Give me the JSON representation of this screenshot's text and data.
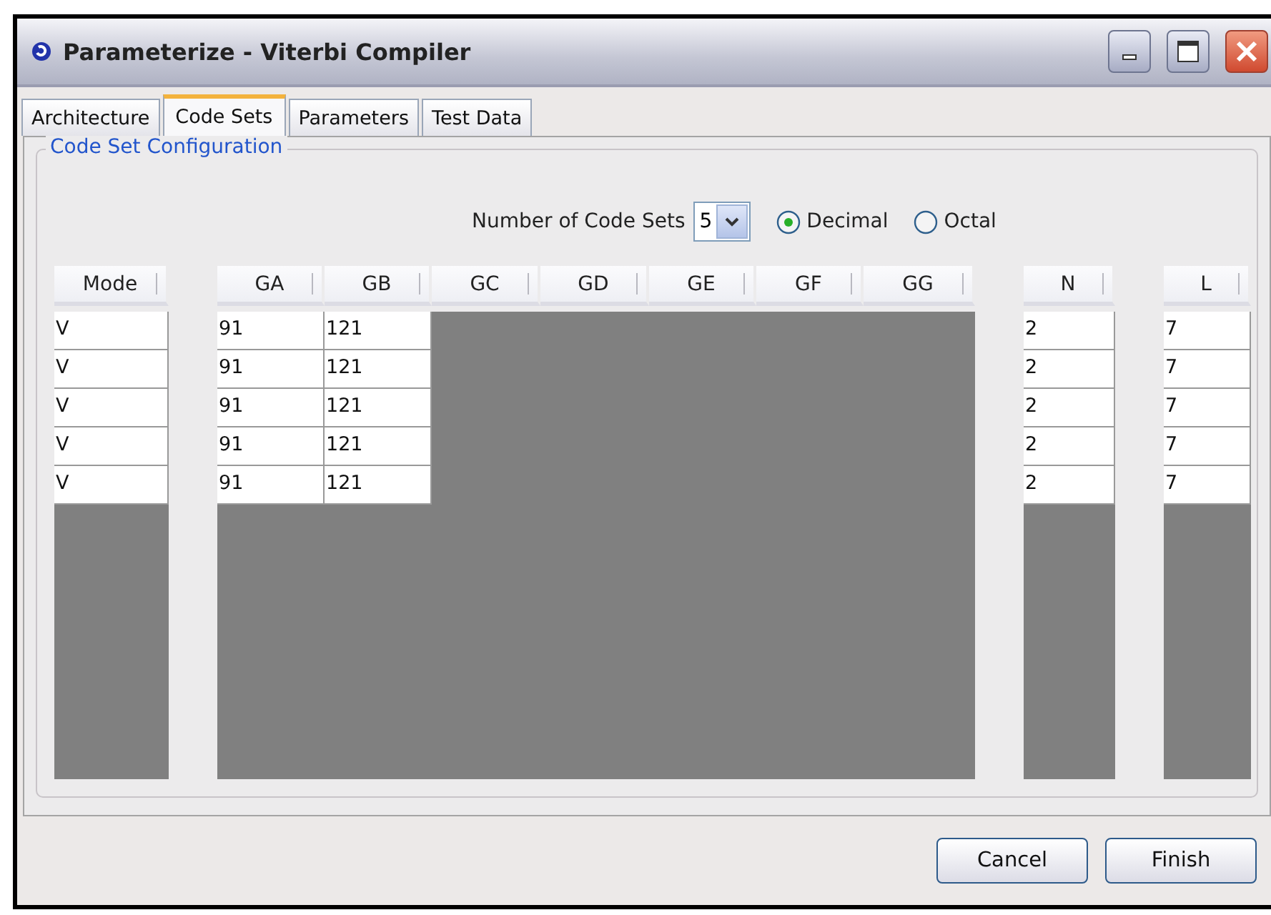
{
  "window": {
    "title": "Parameterize - Viterbi Compiler"
  },
  "tabs": [
    {
      "label": "Architecture",
      "selected": false
    },
    {
      "label": "Code Sets",
      "selected": true
    },
    {
      "label": "Parameters",
      "selected": false
    },
    {
      "label": "Test Data",
      "selected": false
    }
  ],
  "group": {
    "title": "Code Set Configuration"
  },
  "code_sets": {
    "label": "Number of Code Sets",
    "value": "5"
  },
  "radix": [
    {
      "label": "Decimal",
      "selected": true
    },
    {
      "label": "Octal",
      "selected": false
    }
  ],
  "tables": [
    {
      "columns": [
        "Mode"
      ],
      "rows": [
        [
          "V"
        ],
        [
          "V"
        ],
        [
          "V"
        ],
        [
          "V"
        ],
        [
          "V"
        ]
      ]
    },
    {
      "columns": [
        "GA",
        "GB",
        "GC",
        "GD",
        "GE",
        "GF",
        "GG"
      ],
      "rows": [
        [
          "91",
          "121"
        ],
        [
          "91",
          "121"
        ],
        [
          "91",
          "121"
        ],
        [
          "91",
          "121"
        ],
        [
          "91",
          "121"
        ]
      ]
    },
    {
      "columns": [
        "N"
      ],
      "rows": [
        [
          "2"
        ],
        [
          "2"
        ],
        [
          "2"
        ],
        [
          "2"
        ],
        [
          "2"
        ]
      ]
    },
    {
      "columns": [
        "L"
      ],
      "rows": [
        [
          "7"
        ],
        [
          "7"
        ],
        [
          "7"
        ],
        [
          "7"
        ],
        [
          "7"
        ]
      ]
    }
  ],
  "buttons": [
    "Cancel",
    "Finish"
  ]
}
